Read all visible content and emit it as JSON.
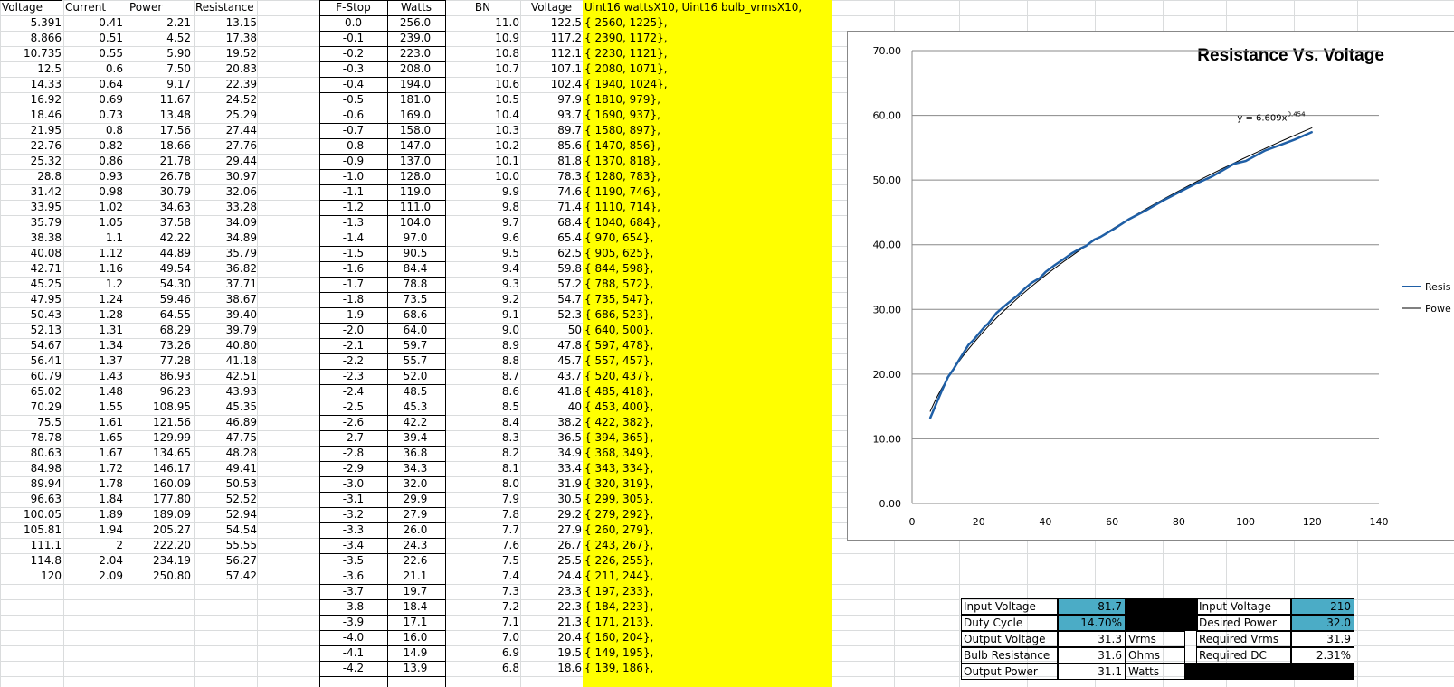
{
  "sheet": {
    "left_headers": [
      "Voltage",
      "Current",
      "Power",
      "Resistance"
    ],
    "left_rows": [
      [
        "5.391",
        "0.41",
        "2.21",
        "13.15"
      ],
      [
        "8.866",
        "0.51",
        "4.52",
        "17.38"
      ],
      [
        "10.735",
        "0.55",
        "5.90",
        "19.52"
      ],
      [
        "12.5",
        "0.6",
        "7.50",
        "20.83"
      ],
      [
        "14.33",
        "0.64",
        "9.17",
        "22.39"
      ],
      [
        "16.92",
        "0.69",
        "11.67",
        "24.52"
      ],
      [
        "18.46",
        "0.73",
        "13.48",
        "25.29"
      ],
      [
        "21.95",
        "0.8",
        "17.56",
        "27.44"
      ],
      [
        "22.76",
        "0.82",
        "18.66",
        "27.76"
      ],
      [
        "25.32",
        "0.86",
        "21.78",
        "29.44"
      ],
      [
        "28.8",
        "0.93",
        "26.78",
        "30.97"
      ],
      [
        "31.42",
        "0.98",
        "30.79",
        "32.06"
      ],
      [
        "33.95",
        "1.02",
        "34.63",
        "33.28"
      ],
      [
        "35.79",
        "1.05",
        "37.58",
        "34.09"
      ],
      [
        "38.38",
        "1.1",
        "42.22",
        "34.89"
      ],
      [
        "40.08",
        "1.12",
        "44.89",
        "35.79"
      ],
      [
        "42.71",
        "1.16",
        "49.54",
        "36.82"
      ],
      [
        "45.25",
        "1.2",
        "54.30",
        "37.71"
      ],
      [
        "47.95",
        "1.24",
        "59.46",
        "38.67"
      ],
      [
        "50.43",
        "1.28",
        "64.55",
        "39.40"
      ],
      [
        "52.13",
        "1.31",
        "68.29",
        "39.79"
      ],
      [
        "54.67",
        "1.34",
        "73.26",
        "40.80"
      ],
      [
        "56.41",
        "1.37",
        "77.28",
        "41.18"
      ],
      [
        "60.79",
        "1.43",
        "86.93",
        "42.51"
      ],
      [
        "65.02",
        "1.48",
        "96.23",
        "43.93"
      ],
      [
        "70.29",
        "1.55",
        "108.95",
        "45.35"
      ],
      [
        "75.5",
        "1.61",
        "121.56",
        "46.89"
      ],
      [
        "78.78",
        "1.65",
        "129.99",
        "47.75"
      ],
      [
        "80.63",
        "1.67",
        "134.65",
        "48.28"
      ],
      [
        "84.98",
        "1.72",
        "146.17",
        "49.41"
      ],
      [
        "89.94",
        "1.78",
        "160.09",
        "50.53"
      ],
      [
        "96.63",
        "1.84",
        "177.80",
        "52.52"
      ],
      [
        "100.05",
        "1.89",
        "189.09",
        "52.94"
      ],
      [
        "105.81",
        "1.94",
        "205.27",
        "54.54"
      ],
      [
        "111.1",
        "2",
        "222.20",
        "55.55"
      ],
      [
        "114.8",
        "2.04",
        "234.19",
        "56.27"
      ],
      [
        "120",
        "2.09",
        "250.80",
        "57.42"
      ]
    ],
    "right_headers": [
      "F-Stop",
      "Watts",
      "BN",
      "Voltage",
      "Uint16 wattsX10, Uint16 bulb_vrmsX10,"
    ],
    "right_rows": [
      [
        "0.0",
        "256.0",
        "11.0",
        "122.5",
        "{ 2560, 1225},"
      ],
      [
        "-0.1",
        "239.0",
        "10.9",
        "117.2",
        "{ 2390, 1172},"
      ],
      [
        "-0.2",
        "223.0",
        "10.8",
        "112.1",
        "{ 2230, 1121},"
      ],
      [
        "-0.3",
        "208.0",
        "10.7",
        "107.1",
        "{ 2080, 1071},"
      ],
      [
        "-0.4",
        "194.0",
        "10.6",
        "102.4",
        "{ 1940, 1024},"
      ],
      [
        "-0.5",
        "181.0",
        "10.5",
        "97.9",
        "{ 1810, 979},"
      ],
      [
        "-0.6",
        "169.0",
        "10.4",
        "93.7",
        "{ 1690, 937},"
      ],
      [
        "-0.7",
        "158.0",
        "10.3",
        "89.7",
        "{ 1580, 897},"
      ],
      [
        "-0.8",
        "147.0",
        "10.2",
        "85.6",
        "{ 1470, 856},"
      ],
      [
        "-0.9",
        "137.0",
        "10.1",
        "81.8",
        "{ 1370, 818},"
      ],
      [
        "-1.0",
        "128.0",
        "10.0",
        "78.3",
        "{ 1280, 783},"
      ],
      [
        "-1.1",
        "119.0",
        "9.9",
        "74.6",
        "{ 1190, 746},"
      ],
      [
        "-1.2",
        "111.0",
        "9.8",
        "71.4",
        "{ 1110, 714},"
      ],
      [
        "-1.3",
        "104.0",
        "9.7",
        "68.4",
        "{ 1040, 684},"
      ],
      [
        "-1.4",
        "97.0",
        "9.6",
        "65.4",
        "{ 970, 654},"
      ],
      [
        "-1.5",
        "90.5",
        "9.5",
        "62.5",
        "{ 905, 625},"
      ],
      [
        "-1.6",
        "84.4",
        "9.4",
        "59.8",
        "{ 844, 598},"
      ],
      [
        "-1.7",
        "78.8",
        "9.3",
        "57.2",
        "{ 788, 572},"
      ],
      [
        "-1.8",
        "73.5",
        "9.2",
        "54.7",
        "{ 735, 547},"
      ],
      [
        "-1.9",
        "68.6",
        "9.1",
        "52.3",
        "{ 686, 523},"
      ],
      [
        "-2.0",
        "64.0",
        "9.0",
        "50",
        "{ 640, 500},"
      ],
      [
        "-2.1",
        "59.7",
        "8.9",
        "47.8",
        "{ 597, 478},"
      ],
      [
        "-2.2",
        "55.7",
        "8.8",
        "45.7",
        "{ 557, 457},"
      ],
      [
        "-2.3",
        "52.0",
        "8.7",
        "43.7",
        "{ 520, 437},"
      ],
      [
        "-2.4",
        "48.5",
        "8.6",
        "41.8",
        "{ 485, 418},"
      ],
      [
        "-2.5",
        "45.3",
        "8.5",
        "40",
        "{ 453, 400},"
      ],
      [
        "-2.6",
        "42.2",
        "8.4",
        "38.2",
        "{ 422, 382},"
      ],
      [
        "-2.7",
        "39.4",
        "8.3",
        "36.5",
        "{ 394, 365},"
      ],
      [
        "-2.8",
        "36.8",
        "8.2",
        "34.9",
        "{ 368, 349},"
      ],
      [
        "-2.9",
        "34.3",
        "8.1",
        "33.4",
        "{ 343, 334},"
      ],
      [
        "-3.0",
        "32.0",
        "8.0",
        "31.9",
        "{ 320, 319},"
      ],
      [
        "-3.1",
        "29.9",
        "7.9",
        "30.5",
        "{ 299, 305},"
      ],
      [
        "-3.2",
        "27.9",
        "7.8",
        "29.2",
        "{ 279, 292},"
      ],
      [
        "-3.3",
        "26.0",
        "7.7",
        "27.9",
        "{ 260, 279},"
      ],
      [
        "-3.4",
        "24.3",
        "7.6",
        "26.7",
        "{ 243, 267},"
      ],
      [
        "-3.5",
        "22.6",
        "7.5",
        "25.5",
        "{ 226, 255},"
      ],
      [
        "-3.6",
        "21.1",
        "7.4",
        "24.4",
        "{ 211, 244},"
      ],
      [
        "-3.7",
        "19.7",
        "7.3",
        "23.3",
        "{ 197, 233},"
      ],
      [
        "-3.8",
        "18.4",
        "7.2",
        "22.3",
        "{ 184, 223},"
      ],
      [
        "-3.9",
        "17.1",
        "7.1",
        "21.3",
        "{ 171, 213},"
      ],
      [
        "-4.0",
        "16.0",
        "7.0",
        "20.4",
        "{ 160, 204},"
      ],
      [
        "-4.1",
        "14.9",
        "6.9",
        "19.5",
        "{ 149, 195},"
      ],
      [
        "-4.2",
        "13.9",
        "6.8",
        "18.6",
        "{ 139, 186},"
      ]
    ],
    "calc_left": {
      "labels": [
        "Input Voltage",
        "Duty Cycle",
        "Output Voltage",
        "Bulb Resistance",
        "Output Power"
      ],
      "values": [
        "81.7",
        "14.70%",
        "31.3",
        "31.6",
        "31.1"
      ],
      "units": [
        "",
        "",
        "Vrms",
        "Ohms",
        "Watts"
      ]
    },
    "calc_right": {
      "labels": [
        "Input Voltage",
        "Desired Power",
        "Required Vrms",
        "Required DC"
      ],
      "values": [
        "210",
        "32.0",
        "31.9",
        "2.31%"
      ]
    },
    "colors": {
      "highlight": "#ffff00",
      "input_cell": "#4bacc6",
      "series_resistance": "#1f5fa6",
      "series_power": "#000000"
    }
  },
  "chart_data": {
    "type": "scatter",
    "title": "Resistance Vs. Voltage",
    "xlim": [
      0,
      140
    ],
    "ylim": [
      0,
      70
    ],
    "x_ticks": [
      "0",
      "20",
      "40",
      "60",
      "80",
      "100",
      "120",
      "140"
    ],
    "y_ticks": [
      "0.00",
      "10.00",
      "20.00",
      "30.00",
      "40.00",
      "50.00",
      "60.00",
      "70.00"
    ],
    "grid": true,
    "legend_position": "right",
    "series": [
      {
        "name": "Resis",
        "x": [
          5.391,
          8.866,
          10.735,
          12.5,
          14.33,
          16.92,
          18.46,
          21.95,
          22.76,
          25.32,
          28.8,
          31.42,
          33.95,
          35.79,
          38.38,
          40.08,
          42.71,
          45.25,
          47.95,
          50.43,
          52.13,
          54.67,
          56.41,
          60.79,
          65.02,
          70.29,
          75.5,
          78.78,
          80.63,
          84.98,
          89.94,
          96.63,
          100.05,
          105.81,
          111.1,
          114.8,
          120
        ],
        "y": [
          13.15,
          17.38,
          19.52,
          20.83,
          22.39,
          24.52,
          25.29,
          27.44,
          27.76,
          29.44,
          30.97,
          32.06,
          33.28,
          34.09,
          34.89,
          35.79,
          36.82,
          37.71,
          38.67,
          39.4,
          39.79,
          40.8,
          41.18,
          42.51,
          43.93,
          45.35,
          46.89,
          47.75,
          48.28,
          49.41,
          50.53,
          52.52,
          52.94,
          54.54,
          55.55,
          56.27,
          57.42
        ]
      },
      {
        "name": "Powe",
        "trendline": "power",
        "coef": 6.609,
        "exp": 0.454,
        "x_range": [
          5.391,
          120
        ]
      }
    ],
    "annotation": {
      "prefix": "y = 6.609x",
      "exponent": "0.454"
    }
  }
}
